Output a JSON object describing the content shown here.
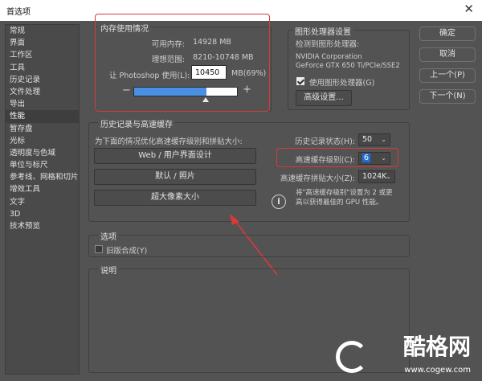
{
  "window": {
    "title": "首选项",
    "close_glyph": "✕"
  },
  "sidebar": {
    "items": [
      {
        "label": "常规"
      },
      {
        "label": "界面"
      },
      {
        "label": "工作区"
      },
      {
        "label": "工具"
      },
      {
        "label": "历史记录"
      },
      {
        "label": "文件处理"
      },
      {
        "label": "导出"
      },
      {
        "label": "性能"
      },
      {
        "label": "暂存盘"
      },
      {
        "label": "光标"
      },
      {
        "label": "透明度与色域"
      },
      {
        "label": "单位与标尺"
      },
      {
        "label": "参考线、网格和切片"
      },
      {
        "label": "增效工具"
      },
      {
        "label": "文字"
      },
      {
        "label": "3D"
      },
      {
        "label": "技术预览"
      }
    ],
    "active_index": 7
  },
  "memory": {
    "title": "内存使用情况",
    "available_label": "可用内存:",
    "available_value": "14928 MB",
    "ideal_label": "理想范围:",
    "ideal_value": "8210-10748 MB",
    "use_label": "让 Photoshop 使用(L):",
    "use_value": "10450",
    "use_suffix": "MB(69%)",
    "slider_fraction": 0.69,
    "minus": "−",
    "plus": "+"
  },
  "gpu": {
    "title": "图形处理器设置",
    "detected_label": "检测到图形处理器:",
    "vendor": "NVIDIA Corporation",
    "model": "GeForce GTX 650 Ti/PCIe/SSE2",
    "use_gpu_label": "使用图形处理器(G)",
    "use_gpu_checked": true,
    "advanced_button": "高级设置..."
  },
  "buttons": {
    "ok": "确定",
    "cancel": "取消",
    "prev": "上一个(P)",
    "next": "下一个(N)"
  },
  "history": {
    "title": "历史记录与高速缓存",
    "hint": "为下面的情况优化高速缓存级别和拼贴大小:",
    "preset_web": "Web / 用户界面设计",
    "preset_default": "默认 / 照片",
    "preset_huge": "超大像素大小",
    "states_label": "历史记录状态(H):",
    "states_value": "50",
    "levels_label": "高速缓存级别(C):",
    "levels_value": "6",
    "tile_label": "高速缓存拼贴大小(Z):",
    "tile_value": "1024K",
    "info_text_1": "将\"高速缓存级别\"设置为 2 或更",
    "info_text_2": "高以获得最佳的 GPU 性能。",
    "info_icon": "i"
  },
  "options": {
    "title": "选项",
    "legacy_label": "旧版合成(Y)",
    "legacy_checked": false
  },
  "description": {
    "title": "说明"
  },
  "watermark": {
    "logo": "G",
    "brand": "酷格网",
    "url": "www.cogew.com"
  },
  "colors": {
    "annotation_red": "#d83a3a",
    "slider_blue": "#4a90e2"
  }
}
